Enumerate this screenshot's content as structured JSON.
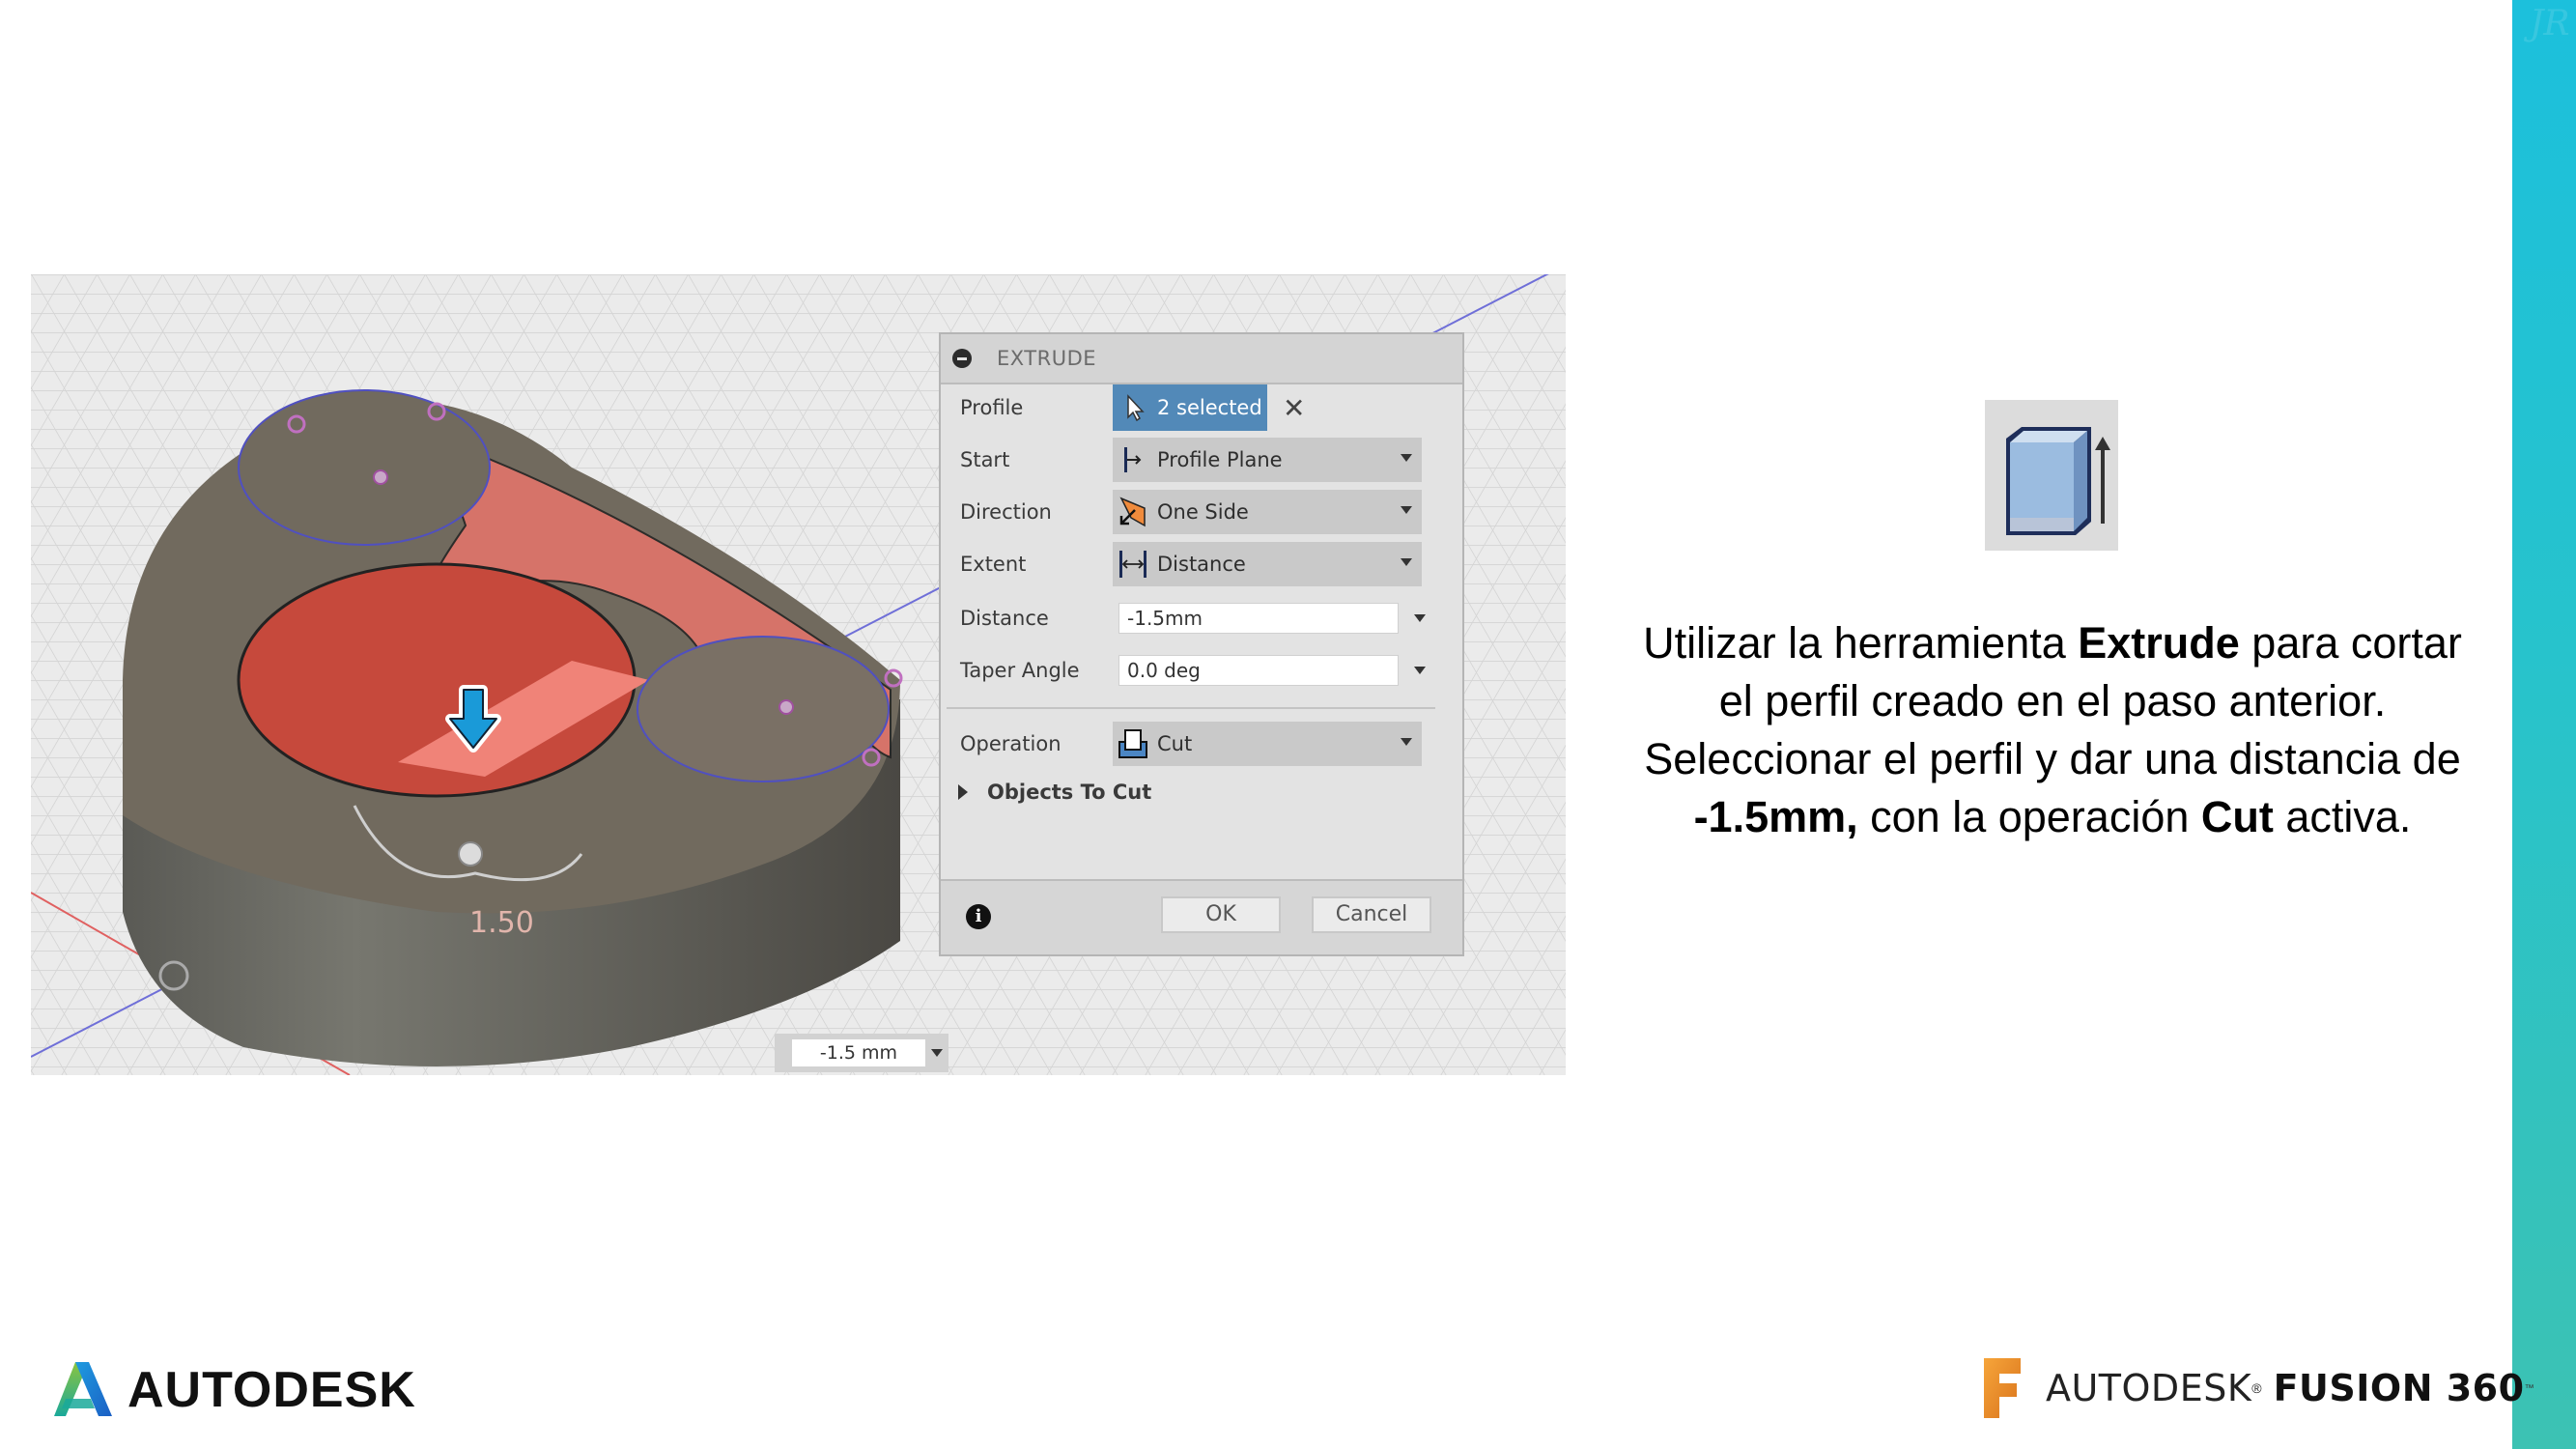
{
  "slide": {
    "watermark": "JR",
    "instructions": {
      "line1_pre": "Utilizar la herramienta ",
      "line1_bold": "Extrude",
      "line1_post": " para cortar el perfil creado en el paso anterior.",
      "line2_pre": "Seleccionar el perfil y dar una distancia de ",
      "line2_bold": "-1.5mm,",
      "line2_mid": " con la operación ",
      "line2_bold2": "Cut",
      "line2_post": " activa."
    },
    "tool_icon": "extrude-icon"
  },
  "colors": {
    "sidebar_top": "#1cc0dc",
    "sidebar_bottom": "#3cc2b3",
    "selection_blue": "#5289b8",
    "cut_preview_red": "#e8756b",
    "body_gray": "#716a5e"
  },
  "viewport": {
    "dimension_label": "1.50",
    "manipulator_value": "-1.5 mm"
  },
  "dialog": {
    "title": "EXTRUDE",
    "rows": {
      "profile": {
        "label": "Profile",
        "value": "2 selected"
      },
      "start": {
        "label": "Start",
        "value": "Profile Plane"
      },
      "direction": {
        "label": "Direction",
        "value": "One Side"
      },
      "extent": {
        "label": "Extent",
        "value": "Distance"
      },
      "distance": {
        "label": "Distance",
        "value": "-1.5mm"
      },
      "taper": {
        "label": "Taper Angle",
        "value": "0.0 deg"
      },
      "operation": {
        "label": "Operation",
        "value": "Cut"
      }
    },
    "group_objects_to_cut": "Objects To Cut",
    "ok_label": "OK",
    "cancel_label": "Cancel",
    "info_glyph": "i",
    "clear_glyph": "✕"
  },
  "logos": {
    "autodesk": "AUTODESK",
    "fusion_brand": "AUTODESK",
    "fusion_reg": "®",
    "fusion_product": "FUSION 360",
    "fusion_tm": "™"
  }
}
